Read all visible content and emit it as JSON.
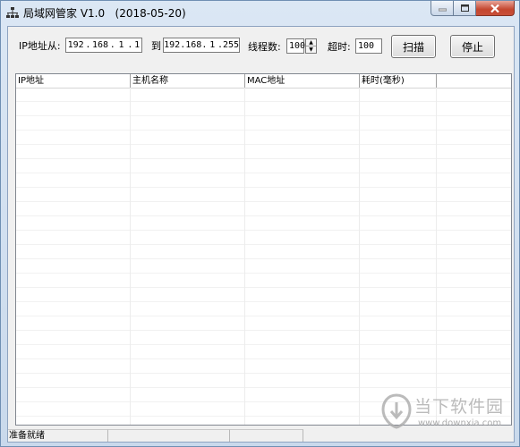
{
  "window": {
    "title": "局域网管家 V1.0   (2018-05-20)",
    "icon": "network-icon",
    "controls": [
      "minimize-icon",
      "maximize-icon",
      "close-icon"
    ]
  },
  "scan": {
    "ip_from_label": "IP地址从:",
    "ip_from": [
      "192",
      "168",
      "1",
      "1"
    ],
    "to_label": "到",
    "ip_to": [
      "192",
      "168",
      "1",
      "255"
    ],
    "threads_label": "线程数:",
    "threads_value": "100",
    "timeout_label": "超时:",
    "timeout_value": "100",
    "scan_button": "扫描",
    "stop_button": "停止"
  },
  "table": {
    "columns": [
      "IP地址",
      "主机名称",
      "MAC地址",
      "耗时(毫秒)"
    ],
    "rows": []
  },
  "status": {
    "text": "准备就绪",
    "pane2": "",
    "pane3": ""
  },
  "watermark": {
    "title": "当下软件园",
    "url": "www.downxia.com"
  },
  "colors": {
    "titlebar": "#dbe7f4",
    "client": "#f0f0f0",
    "close_button": "#c4462f"
  }
}
